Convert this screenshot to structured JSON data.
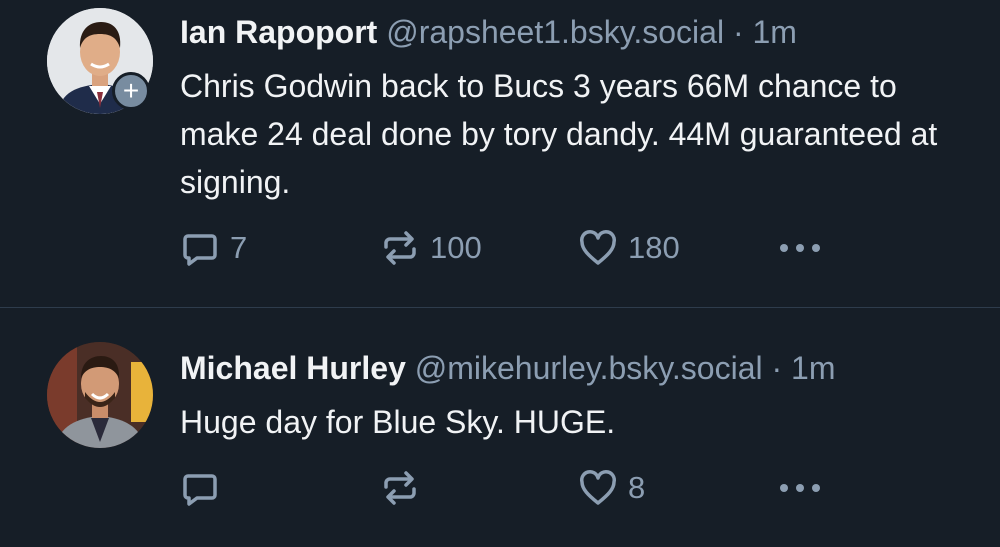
{
  "posts": [
    {
      "author_name": "Ian Rapoport",
      "handle": "@rapsheet1.bsky.social",
      "separator": "·",
      "time": "1m",
      "text": "Chris Godwin back to Bucs 3 years 66M chance to make 24 deal done by tory dandy. 44M guaranteed at signing.",
      "replies": "7",
      "reposts": "100",
      "likes": "180",
      "follow_badge": "+"
    },
    {
      "author_name": "Michael Hurley",
      "handle": "@mikehurley.bsky.social",
      "separator": "·",
      "time": "1m",
      "text": "Huge day for Blue Sky. HUGE.",
      "replies": "",
      "reposts": "",
      "likes": "8"
    }
  ],
  "colors": {
    "background": "#161e27",
    "text": "#f1f3f5",
    "muted": "#8c9eb2",
    "divider": "#2e3c4c"
  },
  "icons": [
    "reply-icon",
    "repost-icon",
    "like-icon",
    "more-icon",
    "follow-plus-icon"
  ]
}
